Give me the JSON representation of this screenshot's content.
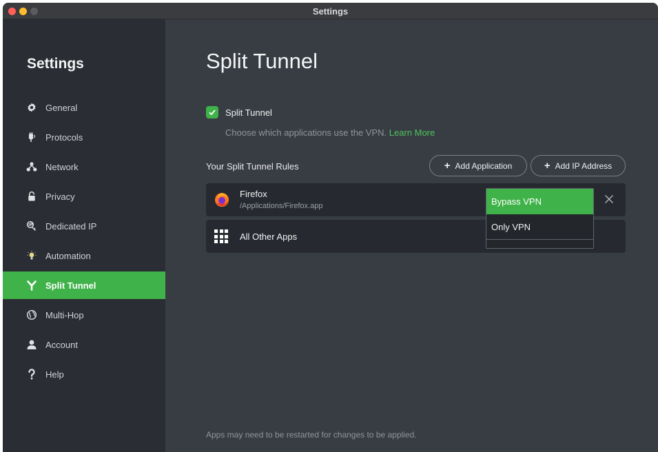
{
  "window": {
    "title": "Settings"
  },
  "sidebar": {
    "title": "Settings",
    "items": [
      {
        "label": "General",
        "icon": "gear-icon"
      },
      {
        "label": "Protocols",
        "icon": "protocols-icon"
      },
      {
        "label": "Network",
        "icon": "network-icon"
      },
      {
        "label": "Privacy",
        "icon": "lock-icon"
      },
      {
        "label": "Dedicated IP",
        "icon": "dedicated-ip-icon"
      },
      {
        "label": "Automation",
        "icon": "automation-icon"
      },
      {
        "label": "Split Tunnel",
        "icon": "split-tunnel-icon",
        "active": true
      },
      {
        "label": "Multi-Hop",
        "icon": "globe-icon"
      },
      {
        "label": "Account",
        "icon": "person-icon"
      },
      {
        "label": "Help",
        "icon": "question-icon"
      }
    ]
  },
  "main": {
    "title": "Split Tunnel",
    "split_tunnel_checkbox": {
      "label": "Split Tunnel",
      "checked": true
    },
    "description": "Choose which applications use the VPN.",
    "learn_more": "Learn More",
    "rules_label": "Your Split Tunnel Rules",
    "add_application": "Add Application",
    "add_ip_address": "Add IP Address",
    "rules": [
      {
        "name": "Firefox",
        "path": "/Applications/Firefox.app",
        "icon": "firefox-icon"
      },
      {
        "name": "All Other Apps",
        "icon": "grid-icon"
      }
    ],
    "dropdown": {
      "options": [
        "Bypass VPN",
        "Only VPN"
      ],
      "selected": "Bypass VPN"
    },
    "footer_note": "Apps may need to be restarted for changes to be applied."
  },
  "colors": {
    "accent": "#3fb349",
    "background": "#383d44",
    "sidebar": "#2a2d33",
    "row": "#262a30"
  }
}
